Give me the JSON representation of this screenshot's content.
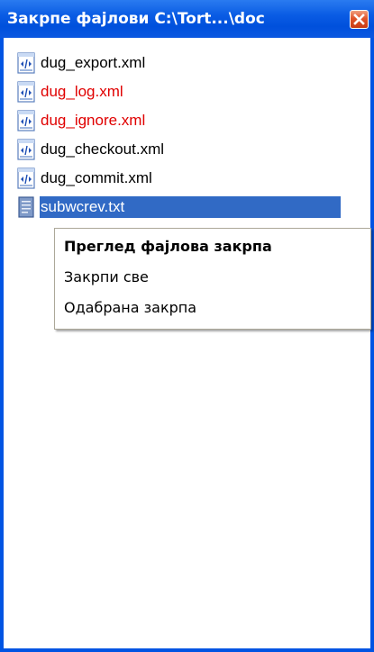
{
  "window": {
    "title": "Закрпе фајлови  C:\\Tort...\\doc",
    "close_icon": "close-x-icon",
    "accent_color": "#0054e3"
  },
  "files": [
    {
      "name": "dug_export.xml",
      "icon": "xml-file-icon",
      "changed": false,
      "selected": false
    },
    {
      "name": "dug_log.xml",
      "icon": "xml-file-icon",
      "changed": true,
      "selected": false
    },
    {
      "name": "dug_ignore.xml",
      "icon": "xml-file-icon",
      "changed": true,
      "selected": false
    },
    {
      "name": "dug_checkout.xml",
      "icon": "xml-file-icon",
      "changed": false,
      "selected": false
    },
    {
      "name": "dug_commit.xml",
      "icon": "xml-file-icon",
      "changed": false,
      "selected": false
    },
    {
      "name": "subwcrev.txt",
      "icon": "text-file-icon",
      "changed": false,
      "selected": true
    }
  ],
  "colors": {
    "changed_text": "#e00000",
    "selection_bg": "#316ac5"
  },
  "context_menu": {
    "items": [
      {
        "label": "Преглед фајлова закрпа",
        "default": true
      },
      {
        "label": "Закрпи све",
        "default": false
      },
      {
        "label": "Одабрана закрпа",
        "default": false
      }
    ]
  }
}
